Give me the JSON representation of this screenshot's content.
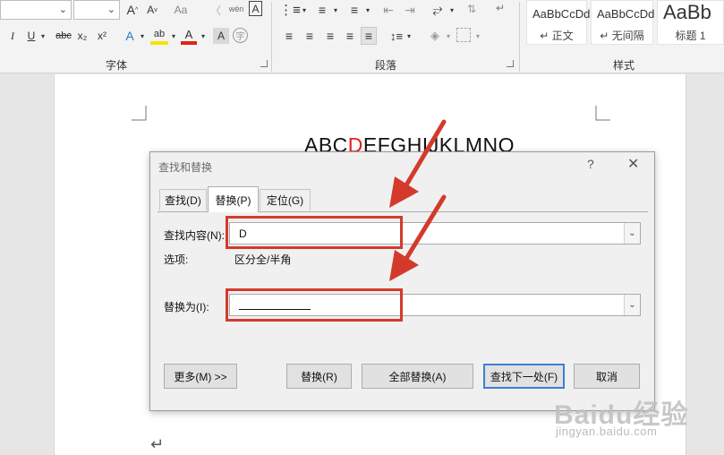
{
  "ribbon": {
    "font_group_label": "字体",
    "paragraph_group_label": "段落",
    "styles_group_label": "样式",
    "font_size_buttons": {
      "grow": "A",
      "shrink": "A",
      "case": "Aa",
      "phonetic": "wén",
      "border_char": "A"
    },
    "format_buttons": {
      "italic": "I",
      "underline": "U",
      "strike": "abc",
      "subscript": "x₂",
      "superscript": "x²",
      "text_effect": "A",
      "highlight": "ab",
      "font_color": "A",
      "shading": "A"
    },
    "styles": [
      {
        "sample": "AaBbCcDd",
        "name": "↵ 正文"
      },
      {
        "sample": "AaBbCcDd",
        "name": "↵ 无间隔"
      },
      {
        "sample": "AaBb",
        "name": "标题 1"
      }
    ]
  },
  "document": {
    "heading_before": "ABC",
    "heading_highlight": "D",
    "heading_after": "EFGHIJKLMNO",
    "paragraph_mark": "↵"
  },
  "dialog": {
    "title": "查找和替换",
    "help": "?",
    "close": "✕",
    "tabs": [
      {
        "label": "查找(D)"
      },
      {
        "label": "替换(P)"
      },
      {
        "label": "定位(G)"
      }
    ],
    "find_label": "查找内容(N):",
    "find_value": "D",
    "options_label": "选项:",
    "options_value": "区分全/半角",
    "replace_label": "替换为(I):",
    "replace_value": "",
    "buttons": {
      "more": "更多(M) >>",
      "replace": "替换(R)",
      "replace_all": "全部替换(A)",
      "find_next": "查找下一处(F)",
      "cancel": "取消"
    }
  },
  "annotation_color": "#d33a2c",
  "watermark": {
    "logo": "Baidu经验",
    "url": "jingyan.baidu.com"
  }
}
